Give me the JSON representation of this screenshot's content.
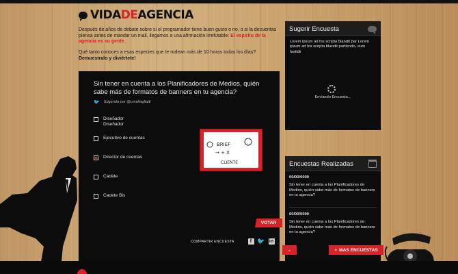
{
  "brand": {
    "logo_part1": "VIDA",
    "logo_part2": "DE",
    "logo_part3": "AGENCIA",
    "accent_color": "#d6232a"
  },
  "intro": {
    "text1": "Después de años de debate sobre si el programador tiene buen gusto o no, o si la decuentas piensa antes de mandar un mail, llegamos a una afirmación irrefutable: ",
    "highlight": "El espíritu de la agencia es su gente.",
    "text2": "Qué tanto conoces a esas especies que te rodean más de 10 horas todas los días?",
    "text3": "Demuestralo y diviértete!"
  },
  "poll": {
    "question": "Sin tener en cuenta a los Planificadores de Medios, quién sabe más de formatos de banners en tu agencia?",
    "suggested_by": "Sugerida por @cmaltagliatti",
    "options": [
      {
        "label": "Diseñador\nDiseñador",
        "selected": false
      },
      {
        "label": "Ejecutivo de cuentas",
        "selected": false
      },
      {
        "label": "Director de cuentas",
        "selected": true
      },
      {
        "label": "Cadete",
        "selected": false
      },
      {
        "label": "Cadete Bis",
        "selected": false
      }
    ],
    "whiteboard": {
      "line1": "BRIEF",
      "line2": "→ + X",
      "line3": "CLIENTE"
    },
    "vote_label": "VOTAR",
    "share_label": "COMPARTIR ENCUESTA"
  },
  "suggest": {
    "title": "Sugerir Encuesta",
    "text_left": "Lorem ipsum ad his scripta blandit par Lorem ipsum ad his scripta blandit partiendo, eum fastidii",
    "sending": "Enviando Encuesta..."
  },
  "completed": {
    "title": "Encuestas Realizadas",
    "items": [
      {
        "date": "00/00/0000",
        "text": "Sin tener en cuenta a los Planificadores de Medios, quién sabe más de formatos de banners en tu agencia?"
      },
      {
        "date": "00/00/0000",
        "text": "Sin tener en cuenta a los Planificadores de Medios, quién sabe más de formatos de banners en tu agencia?"
      }
    ],
    "minus_label": "-",
    "more_label": "MAS ENCUESTAS",
    "more_prefix": "+"
  }
}
